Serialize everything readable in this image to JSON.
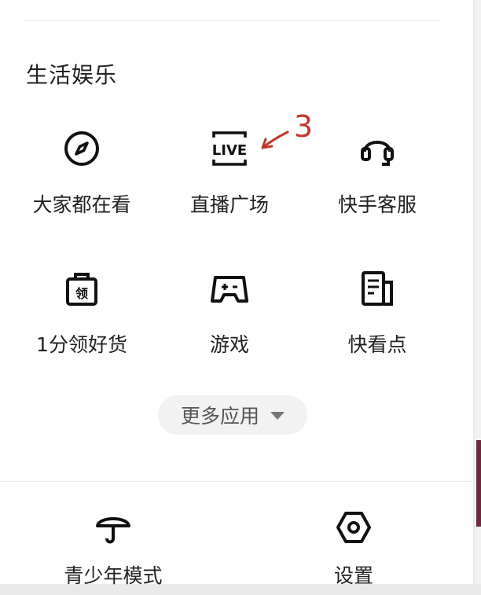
{
  "section": {
    "title": "生活娱乐"
  },
  "grid": [
    {
      "icon": "compass-icon",
      "label": "大家都在看"
    },
    {
      "icon": "live-icon",
      "label": "直播广场",
      "badge_text": "LIVE"
    },
    {
      "icon": "headset-icon",
      "label": "快手客服"
    },
    {
      "icon": "coupon-bag-icon",
      "label": "1分领好货",
      "badge_text": "领"
    },
    {
      "icon": "gamepad-icon",
      "label": "游戏"
    },
    {
      "icon": "news-icon",
      "label": "快看点"
    }
  ],
  "more_button": {
    "label": "更多应用"
  },
  "bottom": [
    {
      "icon": "umbrella-icon",
      "label": "青少年模式"
    },
    {
      "icon": "settings-hex-icon",
      "label": "设置"
    }
  ],
  "annotation": {
    "text": "3",
    "color": "#c0392b"
  }
}
